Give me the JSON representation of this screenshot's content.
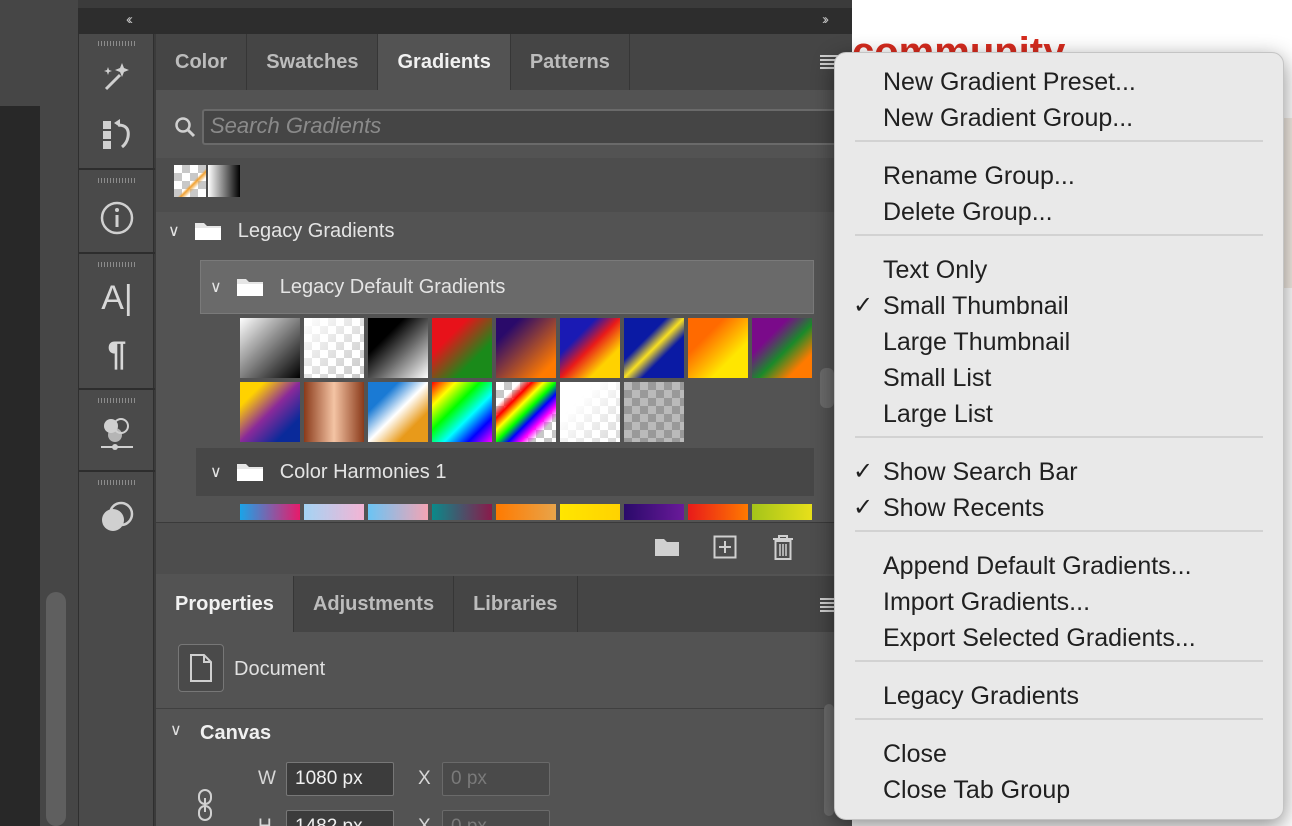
{
  "tool_icons": [
    "magic-wand-icon",
    "history-brush-icon",
    "info-icon",
    "character-icon",
    "paragraph-icon",
    "adjust-icon",
    "blend-icon"
  ],
  "tool_labels": {
    "character": "A|",
    "paragraph": "¶",
    "info": "i"
  },
  "gradients_tabs": [
    {
      "label": "Color",
      "active": false
    },
    {
      "label": "Swatches",
      "active": false
    },
    {
      "label": "Gradients",
      "active": true
    },
    {
      "label": "Patterns",
      "active": false
    }
  ],
  "search": {
    "placeholder": "Search Gradients"
  },
  "groups": {
    "legacy": "Legacy Gradients",
    "legacy_default": "Legacy Default Gradients",
    "harmonies": "Color Harmonies 1"
  },
  "colors": {
    "panel_bg": "#535353",
    "menu_bg": "#e9e9e9",
    "accent_red": "#d62b1e"
  },
  "properties_tabs": [
    {
      "label": "Properties",
      "active": true
    },
    {
      "label": "Adjustments",
      "active": false
    },
    {
      "label": "Libraries",
      "active": false
    }
  ],
  "properties": {
    "document_label": "Document",
    "canvas_label": "Canvas",
    "w_label": "W",
    "h_label": "H",
    "x_label": "X",
    "width_value": "1080 px",
    "height_value": "1482 px",
    "x_value": "0 px",
    "y_value": "0 px"
  },
  "menu": {
    "groups": [
      [
        {
          "label": "New Gradient Preset...",
          "checked": false
        },
        {
          "label": "New Gradient Group...",
          "checked": false
        }
      ],
      [
        {
          "label": "Rename Group...",
          "checked": false
        },
        {
          "label": "Delete Group...",
          "checked": false
        }
      ],
      [
        {
          "label": "Text Only",
          "checked": false
        },
        {
          "label": "Small Thumbnail",
          "checked": true
        },
        {
          "label": "Large Thumbnail",
          "checked": false
        },
        {
          "label": "Small List",
          "checked": false
        },
        {
          "label": "Large List",
          "checked": false
        }
      ],
      [
        {
          "label": "Show Search Bar",
          "checked": true
        },
        {
          "label": "Show Recents",
          "checked": true
        }
      ],
      [
        {
          "label": "Append Default Gradients...",
          "checked": false
        },
        {
          "label": "Import Gradients...",
          "checked": false
        },
        {
          "label": "Export Selected Gradients...",
          "checked": false
        }
      ],
      [
        {
          "label": "Legacy Gradients",
          "checked": false
        }
      ],
      [
        {
          "label": "Close",
          "checked": false
        },
        {
          "label": "Close Tab Group",
          "checked": false
        }
      ]
    ],
    "check_glyph": "✓"
  },
  "background_text": "community",
  "chevrons": {
    "left": "‹‹",
    "right": "››"
  }
}
